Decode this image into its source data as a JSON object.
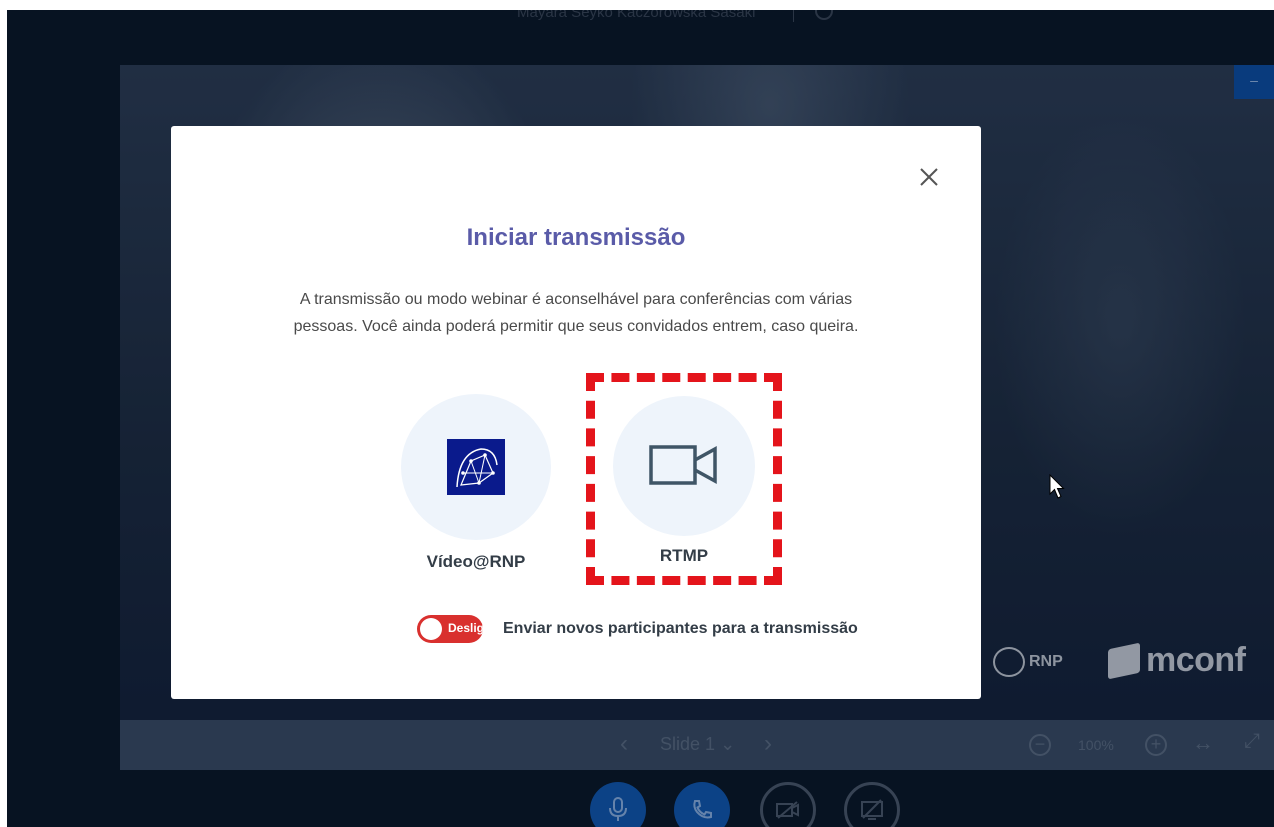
{
  "topbar": {
    "presenter_name": "Mayara Seyko Kaczorowska Sasaki"
  },
  "presentation": {
    "logos": {
      "rnp": "RNP",
      "mconf": "mconf"
    }
  },
  "slidebar": {
    "prev_icon": "‹",
    "next_icon": "›",
    "slide_label": "Slide 1",
    "dropdown_icon": "⌄",
    "zoom_out_icon": "−",
    "zoom_level": "100%",
    "zoom_in_icon": "+",
    "fit_width_icon": "↔",
    "fullscreen_icon": "⤢"
  },
  "actions": [
    "mic-icon",
    "phone-icon",
    "camera-off-icon",
    "screenshare-off-icon"
  ],
  "modal": {
    "title": "Iniciar transmissão",
    "description": "A transmissão ou modo webinar é aconselhável para conferências com várias pessoas. Você ainda poderá permitir que seus convidados entrem, caso queira.",
    "options": [
      {
        "label": "Vídeo@RNP",
        "icon": "rnp-logo-icon"
      },
      {
        "label": "RTMP",
        "icon": "video-camera-icon"
      }
    ],
    "toggle": {
      "state_text": "Deslig",
      "label": "Enviar novos participantes para a transmissão",
      "on": false
    }
  },
  "colors": {
    "title": "#5a5ba8",
    "highlight": "#e4141b",
    "toggle_off": "#d9302e",
    "app_background": "#081626"
  }
}
